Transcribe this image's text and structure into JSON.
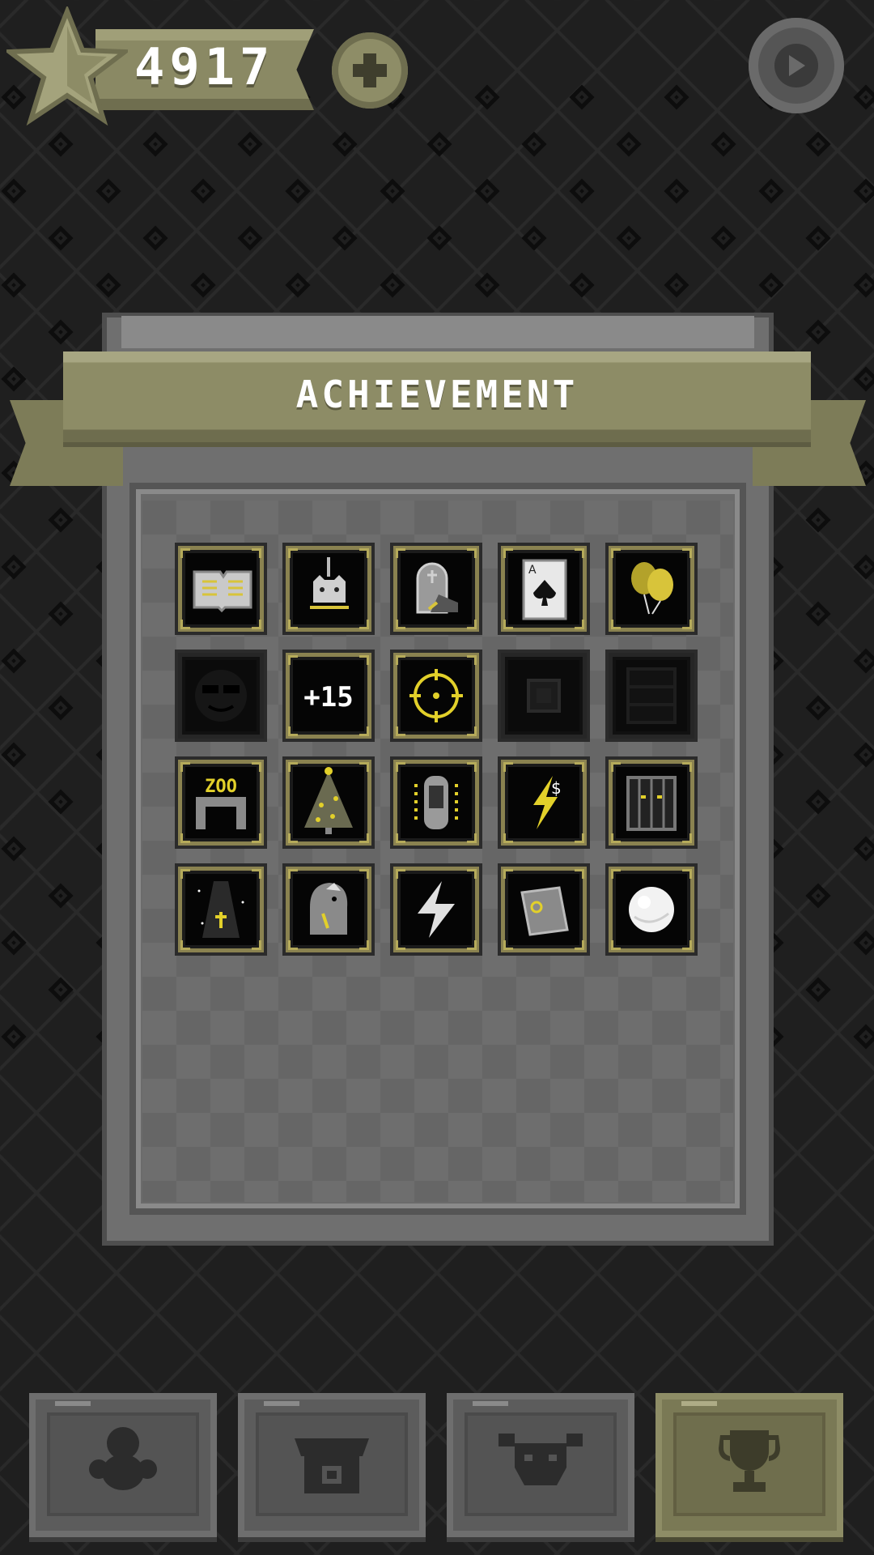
{
  "top_bar": {
    "score": "4917",
    "star_icon": "star-icon",
    "plus_icon": "plus-icon",
    "replay_icon": "play-circle-icon"
  },
  "panel": {
    "title": "ACHIEVEMENT"
  },
  "achievements": [
    {
      "icon": "open-book-icon",
      "unlocked": true
    },
    {
      "icon": "hanging-cat-icon",
      "unlocked": true
    },
    {
      "icon": "tombstone-icon",
      "unlocked": true
    },
    {
      "icon": "ace-of-spades-card-icon",
      "unlocked": true
    },
    {
      "icon": "balloons-icon",
      "unlocked": true
    },
    {
      "icon": "sunglasses-face-icon",
      "unlocked": false
    },
    {
      "icon": "plus-15-icon",
      "label": "+15",
      "unlocked": true
    },
    {
      "icon": "crosshair-icon",
      "unlocked": true
    },
    {
      "icon": "chip-icon",
      "unlocked": false
    },
    {
      "icon": "bookshelf-icon",
      "unlocked": false
    },
    {
      "icon": "zoo-gate-icon",
      "label": "ZOO",
      "unlocked": true
    },
    {
      "icon": "christmas-tree-icon",
      "unlocked": true
    },
    {
      "icon": "capsule-tank-icon",
      "unlocked": true
    },
    {
      "icon": "dollar-lightning-icon",
      "unlocked": true
    },
    {
      "icon": "cage-eyes-icon",
      "unlocked": true
    },
    {
      "icon": "coffin-cross-icon",
      "unlocked": true
    },
    {
      "icon": "rooster-icon",
      "unlocked": true
    },
    {
      "icon": "lightning-bolt-icon",
      "unlocked": true
    },
    {
      "icon": "ticket-card-icon",
      "unlocked": true
    },
    {
      "icon": "white-ball-icon",
      "unlocked": true
    }
  ],
  "bottom_nav": [
    {
      "icon": "creature-icon",
      "active": false
    },
    {
      "icon": "shop-stall-icon",
      "active": false
    },
    {
      "icon": "bull-skull-icon",
      "active": false
    },
    {
      "icon": "trophy-icon",
      "active": true
    }
  ],
  "colors": {
    "background": "#1f1f1f",
    "ribbon": "#8d8c66",
    "tile_border": "#8a8250",
    "accent_gold": "#d8c43a"
  }
}
